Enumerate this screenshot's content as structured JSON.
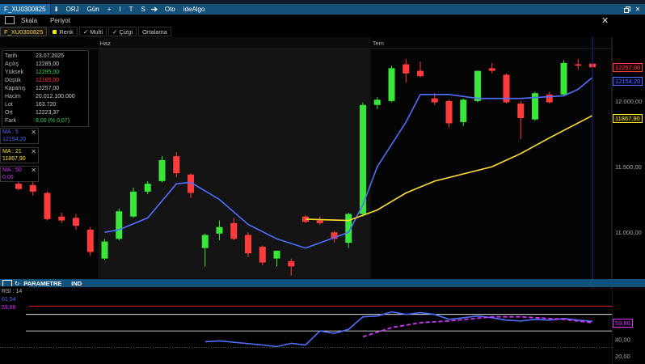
{
  "toolbar": {
    "symbol": "F_XU0300825",
    "items": [
      "ORJ",
      "Gün",
      "+",
      "I",
      "T",
      "S",
      "Oto",
      "ideAlgo"
    ],
    "window_buttons": [
      "⬇",
      "✕"
    ]
  },
  "menu": {
    "items": [
      "Skala",
      "Periyot"
    ]
  },
  "symbol_bar": {
    "symbol": "F_XU0300825",
    "items": [
      "Renk",
      "Multi",
      "Çizgi",
      "Ortalama"
    ]
  },
  "info_panel": {
    "rows": [
      {
        "label": "Tarih",
        "value": "23.07.2025",
        "color": "#cccccc"
      },
      {
        "label": "Açılış",
        "value": "12285,00",
        "color": "#cccccc"
      },
      {
        "label": "Yüksek",
        "value": "12295,00",
        "color": "#39d353"
      },
      {
        "label": "Düşük",
        "value": "12165,00",
        "color": "#ff3b3b"
      },
      {
        "label": "Kapanış",
        "value": "12257,00",
        "color": "#cccccc"
      },
      {
        "label": "Hacim",
        "value": "20.012.100.000",
        "color": "#cccccc"
      },
      {
        "label": "Lot",
        "value": "163.720",
        "color": "#cccccc"
      },
      {
        "label": "Ort",
        "value": "12223,37",
        "color": "#cccccc"
      },
      {
        "label": "Fark",
        "value": "8,00 (% 0,07)",
        "color": "#39d353"
      }
    ]
  },
  "ma_boxes": [
    {
      "label": "MA : 5",
      "value": "12154,20",
      "color": "#4f6fff"
    },
    {
      "label": "MA : 21",
      "value": "11867,90",
      "color": "#ffe033"
    },
    {
      "label": "MA : 50",
      "value": "0,00",
      "color": "#d633ff"
    }
  ],
  "param_bar": {
    "label": "PARAMETRE",
    "ind": "IND"
  },
  "rsi_info": [
    {
      "text": "RSI : 14",
      "color": "#bbbbbb"
    },
    {
      "text": "61,54",
      "color": "#4f6fff"
    },
    {
      "text": "59,86",
      "color": "#d633ff"
    }
  ],
  "price_labels": [
    {
      "text": "12257,00",
      "color": "#ff4040",
      "bg": "#1a0000",
      "y": 12257
    },
    {
      "text": "12154,20",
      "color": "#4f6fff",
      "bg": "#000022",
      "y": 12154.2
    },
    {
      "text": "11867,90",
      "color": "#ffe033",
      "bg": "#1a1a00",
      "y": 11867.9
    }
  ],
  "rsi_label": {
    "text": "59,86",
    "color": "#d633ff",
    "value": 59.86
  },
  "chart_data": {
    "type": "candlestick",
    "x_labels": [
      {
        "label": "Haz",
        "index": 6
      },
      {
        "label": "Tem",
        "index": 25
      }
    ],
    "y_ticks": [
      11000,
      11500,
      12000
    ],
    "ylim": [
      10650,
      12400
    ],
    "candles": [
      {
        "o": 11370,
        "h": 11420,
        "l": 11320,
        "c": 11330
      },
      {
        "o": 11360,
        "h": 11420,
        "l": 11280,
        "c": 11310
      },
      {
        "o": 11300,
        "h": 11310,
        "l": 11090,
        "c": 11100
      },
      {
        "o": 11120,
        "h": 11150,
        "l": 11070,
        "c": 11090
      },
      {
        "o": 11110,
        "h": 11140,
        "l": 11020,
        "c": 11050
      },
      {
        "o": 11020,
        "h": 11040,
        "l": 10820,
        "c": 10850
      },
      {
        "o": 10800,
        "h": 10950,
        "l": 10790,
        "c": 10930
      },
      {
        "o": 10950,
        "h": 11180,
        "l": 10940,
        "c": 11160
      },
      {
        "o": 11120,
        "h": 11340,
        "l": 11110,
        "c": 11310
      },
      {
        "o": 11310,
        "h": 11390,
        "l": 11290,
        "c": 11370
      },
      {
        "o": 11390,
        "h": 11580,
        "l": 11380,
        "c": 11550
      },
      {
        "o": 11580,
        "h": 11610,
        "l": 11420,
        "c": 11450
      },
      {
        "o": 11440,
        "h": 11450,
        "l": 11260,
        "c": 11300
      },
      {
        "o": 10880,
        "h": 10990,
        "l": 10740,
        "c": 10980
      },
      {
        "o": 10990,
        "h": 11090,
        "l": 10940,
        "c": 11040
      },
      {
        "o": 11070,
        "h": 11110,
        "l": 10940,
        "c": 10950
      },
      {
        "o": 10980,
        "h": 11000,
        "l": 10810,
        "c": 10840
      },
      {
        "o": 10890,
        "h": 10900,
        "l": 10750,
        "c": 10770
      },
      {
        "o": 10800,
        "h": 10850,
        "l": 10740,
        "c": 10860
      },
      {
        "o": 10780,
        "h": 10800,
        "l": 10670,
        "c": 10740
      },
      {
        "o": 11120,
        "h": 11130,
        "l": 11070,
        "c": 11080
      },
      {
        "o": 11090,
        "h": 11120,
        "l": 11060,
        "c": 11070
      },
      {
        "o": 11000,
        "h": 11010,
        "l": 10920,
        "c": 10950
      },
      {
        "o": 10920,
        "h": 11150,
        "l": 10880,
        "c": 11140
      },
      {
        "o": 11140,
        "h": 11990,
        "l": 11120,
        "c": 11970
      },
      {
        "o": 11970,
        "h": 12030,
        "l": 11940,
        "c": 12010
      },
      {
        "o": 12000,
        "h": 12270,
        "l": 11990,
        "c": 12250
      },
      {
        "o": 12280,
        "h": 12320,
        "l": 12140,
        "c": 12210
      },
      {
        "o": 12230,
        "h": 12300,
        "l": 12180,
        "c": 12190
      },
      {
        "o": 12020,
        "h": 12060,
        "l": 11970,
        "c": 11990
      },
      {
        "o": 12000,
        "h": 12010,
        "l": 11800,
        "c": 11830
      },
      {
        "o": 11840,
        "h": 12020,
        "l": 11810,
        "c": 12010
      },
      {
        "o": 12000,
        "h": 12230,
        "l": 11990,
        "c": 12230
      },
      {
        "o": 12250,
        "h": 12290,
        "l": 12210,
        "c": 12230
      },
      {
        "o": 12200,
        "h": 12210,
        "l": 11980,
        "c": 11990
      },
      {
        "o": 11980,
        "h": 12000,
        "l": 11710,
        "c": 11870
      },
      {
        "o": 11860,
        "h": 12070,
        "l": 11850,
        "c": 12060
      },
      {
        "o": 12050,
        "h": 12070,
        "l": 11980,
        "c": 11990
      },
      {
        "o": 12050,
        "h": 12310,
        "l": 12040,
        "c": 12290
      },
      {
        "o": 12280,
        "h": 12320,
        "l": 12240,
        "c": 12270
      },
      {
        "o": 12285,
        "h": 12295,
        "l": 12165,
        "c": 12257
      }
    ],
    "ma5": [
      {
        "i": 6,
        "v": 11000
      },
      {
        "i": 7,
        "v": 11020
      },
      {
        "i": 9,
        "v": 11110
      },
      {
        "i": 11,
        "v": 11370
      },
      {
        "i": 12,
        "v": 11380
      },
      {
        "i": 14,
        "v": 11250
      },
      {
        "i": 16,
        "v": 11060
      },
      {
        "i": 18,
        "v": 10950
      },
      {
        "i": 20,
        "v": 10880
      },
      {
        "i": 22,
        "v": 10960
      },
      {
        "i": 23,
        "v": 11000
      },
      {
        "i": 24,
        "v": 11210
      },
      {
        "i": 25,
        "v": 11500
      },
      {
        "i": 27,
        "v": 11840
      },
      {
        "i": 28,
        "v": 12050
      },
      {
        "i": 30,
        "v": 12050
      },
      {
        "i": 32,
        "v": 12020
      },
      {
        "i": 35,
        "v": 12020
      },
      {
        "i": 38,
        "v": 12040
      },
      {
        "i": 39,
        "v": 12090
      },
      {
        "i": 40,
        "v": 12180
      }
    ],
    "ma21": [
      {
        "i": 20,
        "v": 11100
      },
      {
        "i": 23,
        "v": 11090
      },
      {
        "i": 25,
        "v": 11170
      },
      {
        "i": 27,
        "v": 11300
      },
      {
        "i": 29,
        "v": 11390
      },
      {
        "i": 33,
        "v": 11500
      },
      {
        "i": 35,
        "v": 11600
      },
      {
        "i": 37,
        "v": 11720
      },
      {
        "i": 40,
        "v": 11890
      }
    ],
    "rsi": {
      "ylim": [
        10,
        100
      ],
      "levels": [
        {
          "v": 80,
          "color": "#ff2020"
        },
        {
          "v": 70,
          "color": "#ffffff"
        },
        {
          "v": 50,
          "color": "#ffffff"
        }
      ],
      "y_ticks": [
        40,
        20
      ],
      "line": [
        {
          "i": 13,
          "v": 37
        },
        {
          "i": 14,
          "v": 38
        },
        {
          "i": 17,
          "v": 33
        },
        {
          "i": 18,
          "v": 31
        },
        {
          "i": 19,
          "v": 35
        },
        {
          "i": 20,
          "v": 33
        },
        {
          "i": 21,
          "v": 50
        },
        {
          "i": 22,
          "v": 47
        },
        {
          "i": 23,
          "v": 52
        },
        {
          "i": 24,
          "v": 67
        },
        {
          "i": 25,
          "v": 68
        },
        {
          "i": 26,
          "v": 73
        },
        {
          "i": 27,
          "v": 70
        },
        {
          "i": 28,
          "v": 72
        },
        {
          "i": 29,
          "v": 70
        },
        {
          "i": 30,
          "v": 64
        },
        {
          "i": 31,
          "v": 66
        },
        {
          "i": 32,
          "v": 68
        },
        {
          "i": 33,
          "v": 66
        },
        {
          "i": 34,
          "v": 63
        },
        {
          "i": 35,
          "v": 62
        },
        {
          "i": 36,
          "v": 64
        },
        {
          "i": 37,
          "v": 63
        },
        {
          "i": 38,
          "v": 65
        },
        {
          "i": 39,
          "v": 63
        },
        {
          "i": 40,
          "v": 61.54
        }
      ],
      "signal": [
        {
          "i": 24,
          "v": 43
        },
        {
          "i": 26,
          "v": 54
        },
        {
          "i": 28,
          "v": 60
        },
        {
          "i": 30,
          "v": 62
        },
        {
          "i": 33,
          "v": 67
        },
        {
          "i": 35,
          "v": 67
        },
        {
          "i": 38,
          "v": 64
        },
        {
          "i": 40,
          "v": 60
        }
      ]
    }
  }
}
